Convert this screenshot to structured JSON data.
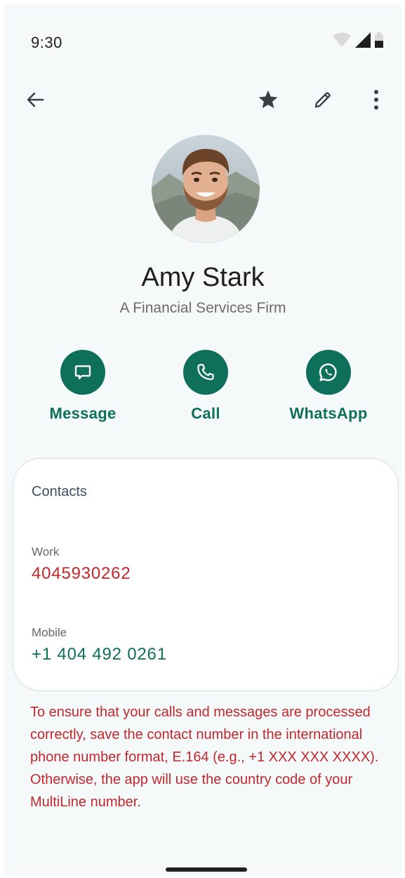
{
  "status_bar": {
    "time": "9:30"
  },
  "top_bar": {
    "back_icon": "arrow-left-icon",
    "star_icon": "star-icon",
    "edit_icon": "pencil-icon",
    "more_icon": "more-vertical-icon"
  },
  "contact": {
    "name": "Amy Stark",
    "company": "A Financial Services Firm"
  },
  "actions": [
    {
      "label": "Message",
      "icon": "message-icon"
    },
    {
      "label": "Call",
      "icon": "phone-icon"
    },
    {
      "label": "WhatsApp",
      "icon": "whatsapp-icon"
    }
  ],
  "contacts_card": {
    "title": "Contacts",
    "fields": [
      {
        "label": "Work",
        "value": "4045930262",
        "color": "#c0282b"
      },
      {
        "label": "Mobile",
        "value": "+1 404 492 0261",
        "color": "#0e6f5b"
      }
    ]
  },
  "warning": "To ensure that your calls and messages are processed correctly, save the contact number in the international phone number format, E.164 (e.g., +1 XXX XXX XXXX). Otherwise, the app will use the country code of your MultiLine number.",
  "colors": {
    "accent": "#0e6f5b",
    "error": "#c0282b",
    "background": "#f6f9fa"
  }
}
